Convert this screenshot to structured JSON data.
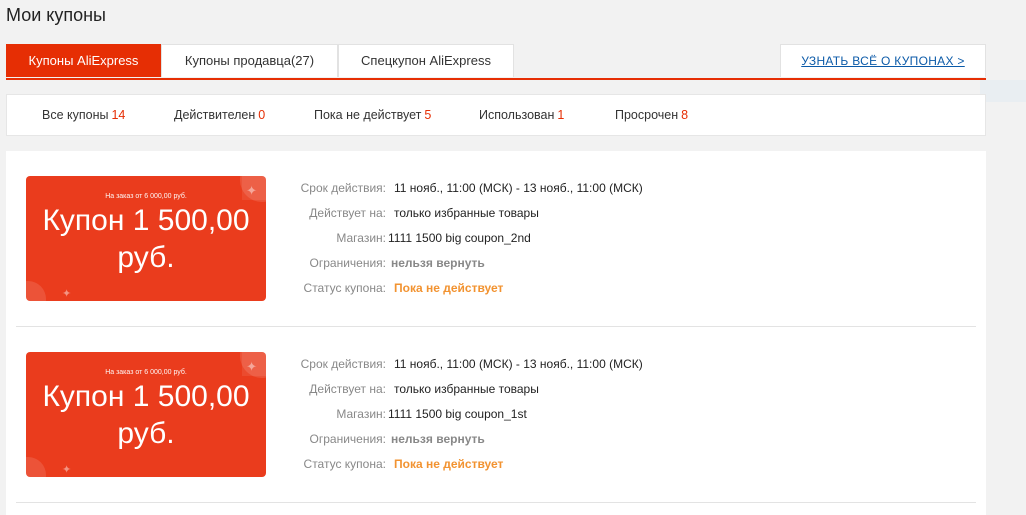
{
  "page": {
    "title": "Мои купоны"
  },
  "tabs": [
    {
      "label": "Купоны AliExpress"
    },
    {
      "label": "Купоны продавца(27)"
    },
    {
      "label": "Спецкупон AliExpress"
    }
  ],
  "learn_more": "УЗНАТЬ ВСЁ О КУПОНАХ >",
  "filters": [
    {
      "label": "Все купоны",
      "count": "14"
    },
    {
      "label": "Действителен",
      "count": "0"
    },
    {
      "label": "Пока не действует",
      "count": "5"
    },
    {
      "label": "Использован",
      "count": "1"
    },
    {
      "label": "Просрочен",
      "count": "8"
    }
  ],
  "labels": {
    "period": "Срок действия:",
    "applies": "Действует на:",
    "store": "Магазин:",
    "restrictions": "Ограничения:",
    "status": "Статус купона:"
  },
  "coupons": [
    {
      "min_order": "На заказ от 6 000,00 руб.",
      "value_line1": "Купон 1 500,00",
      "value_line2": "руб.",
      "period": "11 нояб., 11:00 (МСК) - 13 нояб., 11:00 (МСК)",
      "applies": "только избранные товары",
      "store": "1111 1500 big coupon_2nd",
      "restrictions": "нельзя вернуть",
      "status": "Пока не действует"
    },
    {
      "min_order": "На заказ от 6 000,00 руб.",
      "value_line1": "Купон 1 500,00",
      "value_line2": "руб.",
      "period": "11 нояб., 11:00 (МСК) - 13 нояб., 11:00 (МСК)",
      "applies": "только избранные товары",
      "store": "1111 1500 big coupon_1st",
      "restrictions": "нельзя вернуть",
      "status": "Пока не действует"
    }
  ],
  "colors": {
    "accent": "#e62e04",
    "card": "#ea3c1d",
    "status": "#f29331",
    "link": "#0b5aa8"
  }
}
